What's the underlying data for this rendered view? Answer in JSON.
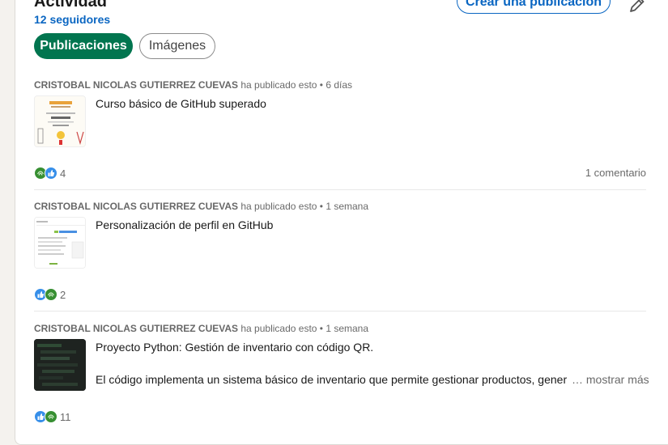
{
  "section": {
    "title": "Actividad",
    "followers": "12 seguidores",
    "create_post_label": "Crear una publicación"
  },
  "tabs": [
    {
      "label": "Publicaciones",
      "active": true
    },
    {
      "label": "Imágenes",
      "active": false
    }
  ],
  "posts": [
    {
      "author": "CRISTOBAL NICOLAS GUTIERREZ CUEVAS",
      "action": "ha publicado esto",
      "time": "• 6 días",
      "text": "Curso básico de GitHub superado",
      "reaction_icons": [
        "support-icon",
        "like-icon"
      ],
      "reaction_count": "4",
      "comments": "1 comentario"
    },
    {
      "author": "CRISTOBAL NICOLAS GUTIERREZ CUEVAS",
      "action": "ha publicado esto",
      "time": "• 1 semana",
      "text": "Personalización de perfil en GitHub",
      "reaction_icons": [
        "like-icon",
        "support-icon"
      ],
      "reaction_count": "2"
    },
    {
      "author": "CRISTOBAL NICOLAS GUTIERREZ CUEVAS",
      "action": "ha publicado esto",
      "time": "• 1 semana",
      "text": "Proyecto Python: Gestión de inventario con código QR.",
      "description": "El código implementa un sistema básico de inventario que permite gestionar productos, gener",
      "more_label": "… mostrar más",
      "reaction_icons": [
        "like-icon",
        "support-icon"
      ],
      "reaction_count": "11"
    }
  ],
  "colors": {
    "accent": "#0a66c2",
    "active_tab": "#01754f",
    "support_green": "#378f32",
    "like_blue": "#378fe9"
  }
}
